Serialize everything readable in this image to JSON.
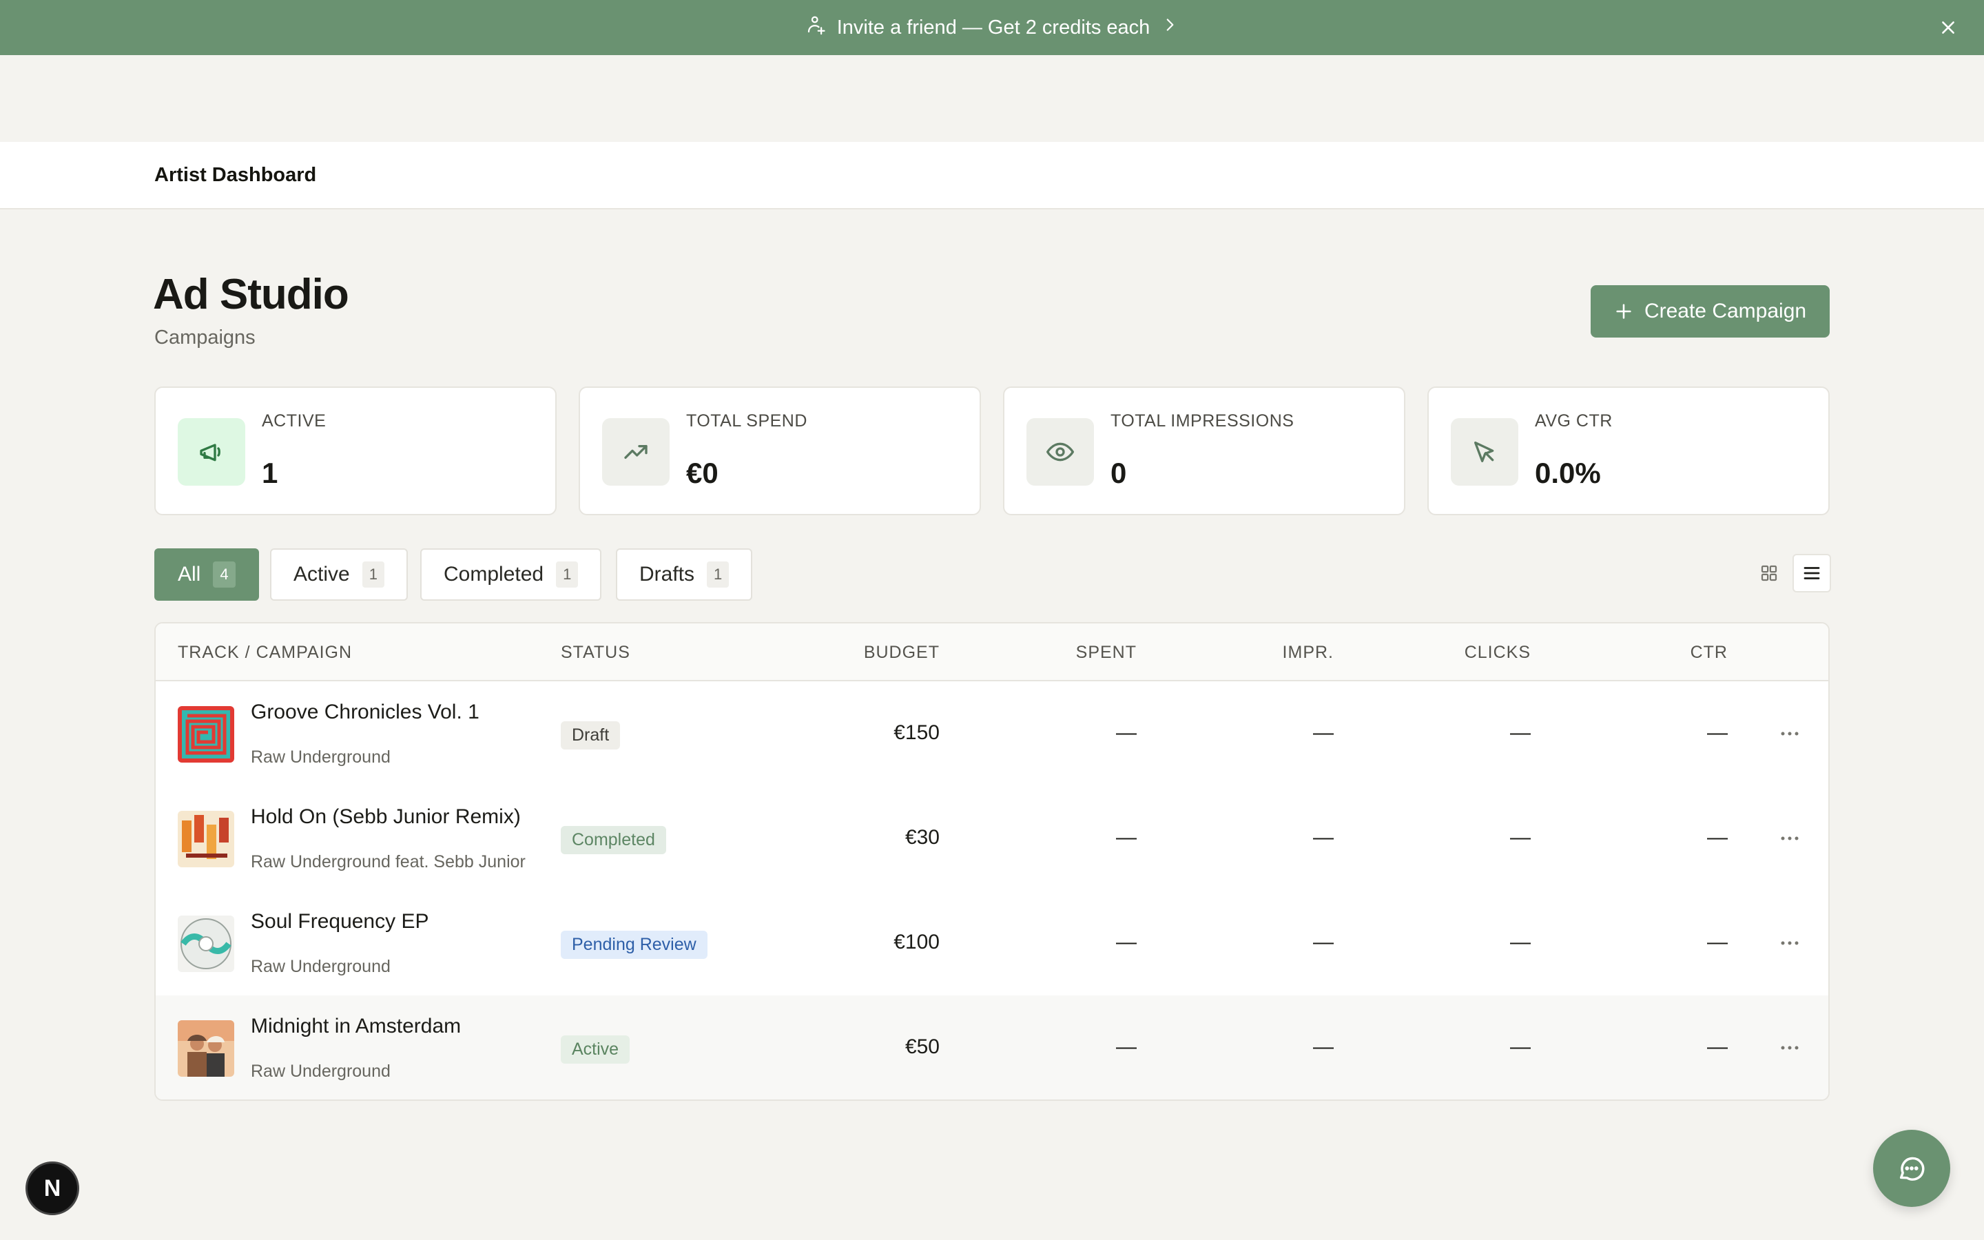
{
  "banner": {
    "text": "Invite a friend — Get 2 credits each",
    "icon": "gift-user-icon"
  },
  "nav": {
    "brand": "Artist Dashboard"
  },
  "header": {
    "title": "Ad Studio",
    "subtitle": "Campaigns",
    "create_label": "Create Campaign"
  },
  "stats": [
    {
      "label": "ACTIVE",
      "value": "1",
      "icon": "megaphone-icon"
    },
    {
      "label": "TOTAL SPEND",
      "value": "€0",
      "icon": "trending-up-icon"
    },
    {
      "label": "TOTAL IMPRESSIONS",
      "value": "0",
      "icon": "eye-icon"
    },
    {
      "label": "AVG CTR",
      "value": "0.0%",
      "icon": "cursor-icon"
    }
  ],
  "tabs": [
    {
      "label": "All",
      "count": "4"
    },
    {
      "label": "Active",
      "count": "1"
    },
    {
      "label": "Completed",
      "count": "1"
    },
    {
      "label": "Drafts",
      "count": "1"
    }
  ],
  "table": {
    "columns": [
      "TRACK / CAMPAIGN",
      "STATUS",
      "BUDGET",
      "SPENT",
      "IMPR.",
      "CLICKS",
      "CTR"
    ],
    "rows": [
      {
        "title": "Groove Chronicles Vol. 1",
        "artist": "Raw Underground",
        "status": "Draft",
        "budget": "€150",
        "spent": "—",
        "impr": "—",
        "clicks": "—",
        "ctr": "—"
      },
      {
        "title": "Hold On (Sebb Junior Remix)",
        "artist": "Raw Underground feat. Sebb Junior",
        "status": "Completed",
        "budget": "€30",
        "spent": "—",
        "impr": "—",
        "clicks": "—",
        "ctr": "—"
      },
      {
        "title": "Soul Frequency EP",
        "artist": "Raw Underground",
        "status": "Pending Review",
        "budget": "€100",
        "spent": "—",
        "impr": "—",
        "clicks": "—",
        "ctr": "—"
      },
      {
        "title": "Midnight in Amsterdam",
        "artist": "Raw Underground",
        "status": "Active",
        "budget": "€50",
        "spent": "—",
        "impr": "—",
        "clicks": "—",
        "ctr": "—"
      }
    ]
  },
  "floating": {
    "dev_badge": "N"
  },
  "colors": {
    "accent": "#6a9271",
    "background": "#f4f3ef"
  }
}
